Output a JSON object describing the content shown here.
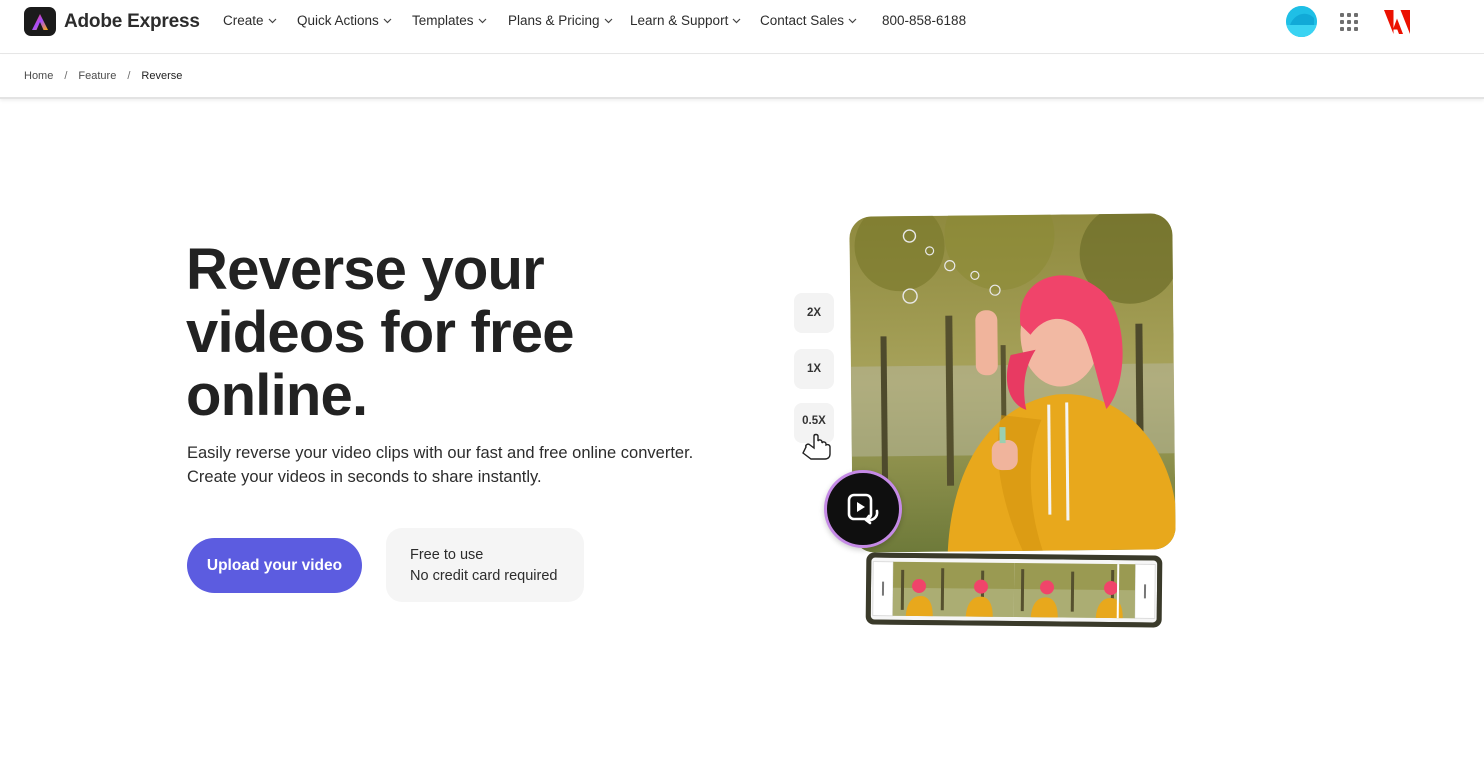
{
  "brand": {
    "name": "Adobe Express"
  },
  "nav": {
    "items": [
      {
        "label": "Create"
      },
      {
        "label": "Quick Actions"
      },
      {
        "label": "Templates"
      },
      {
        "label": "Plans & Pricing"
      },
      {
        "label": "Learn & Support"
      },
      {
        "label": "Contact Sales"
      }
    ],
    "phone": "800-858-6188"
  },
  "breadcrumb": {
    "items": [
      "Home",
      "Feature",
      "Reverse"
    ],
    "separator": "/"
  },
  "hero": {
    "title": "Reverse your videos for free online.",
    "subtitle_line1": "Easily reverse your video clips with our fast and free online converter.",
    "subtitle_line2": "Create your videos in seconds to share instantly.",
    "cta_label": "Upload your video",
    "free_line1": "Free to use",
    "free_line2": "No credit card required"
  },
  "illustration": {
    "speeds": [
      "2X",
      "1X",
      "0.5X"
    ]
  },
  "colors": {
    "accent": "#5c5ce0",
    "adobe_red": "#eb1000",
    "avatar": "#1fbfe6",
    "sweater": "#e8a81c",
    "hair": "#f0446a"
  }
}
